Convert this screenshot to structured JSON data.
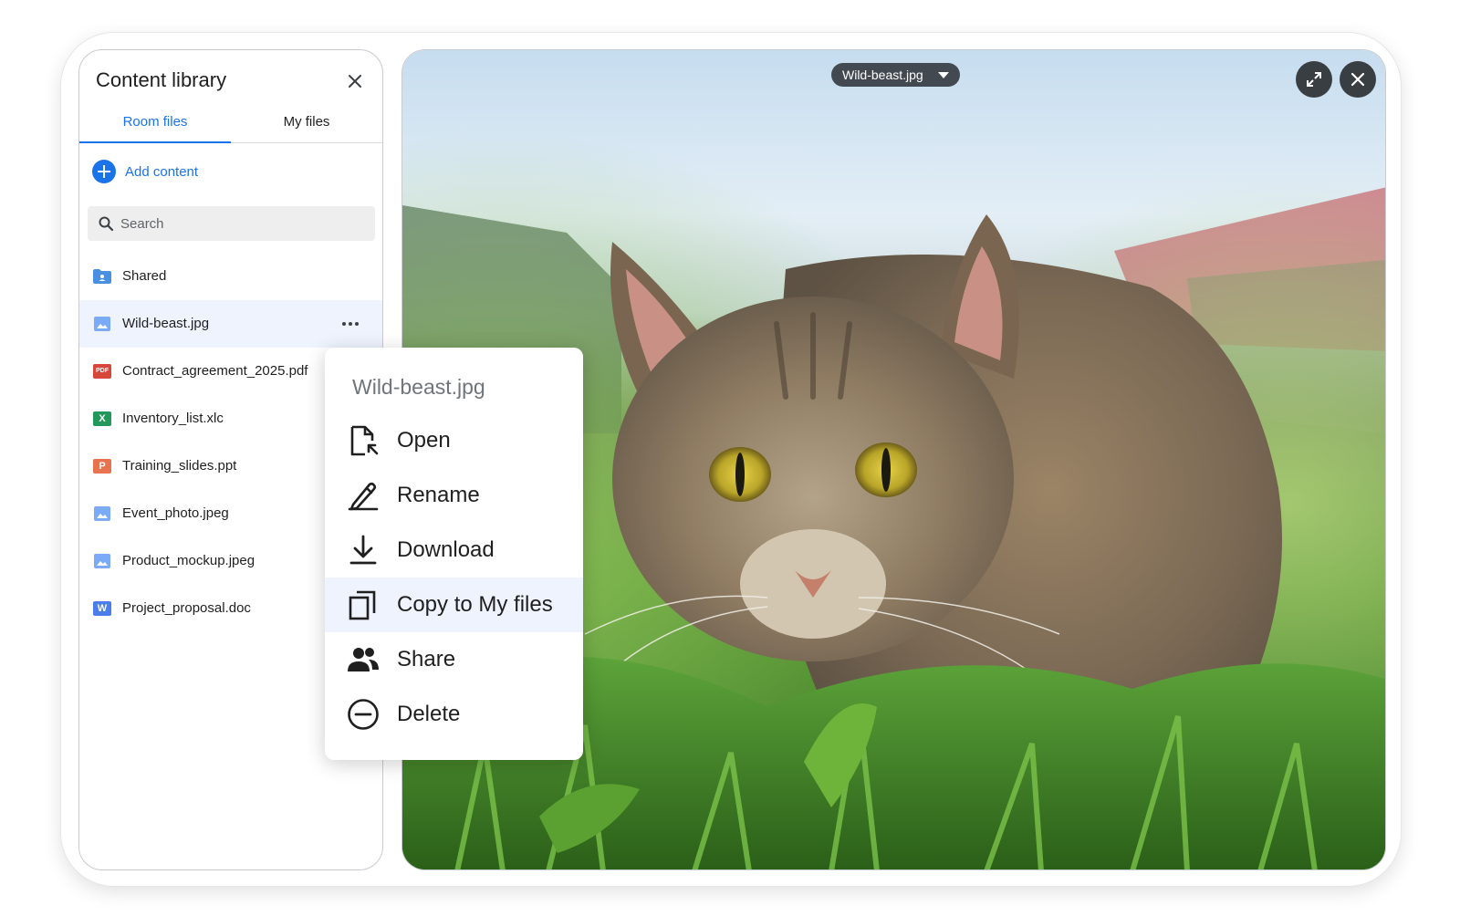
{
  "sidebar": {
    "title": "Content library",
    "tabs": [
      {
        "label": "Room files",
        "active": true
      },
      {
        "label": "My files",
        "active": false
      }
    ],
    "add_content_label": "Add content",
    "search_placeholder": "Search",
    "files": [
      {
        "name": "Shared",
        "icon": "shared-folder-icon",
        "color": "#4a90e2"
      },
      {
        "name": "Wild-beast.jpg",
        "icon": "image-file-icon",
        "color": "#7baaf7",
        "selected": true
      },
      {
        "name": "Contract_agreement_2025.pdf",
        "icon": "pdf-file-icon",
        "color": "#d6473a",
        "letter": "PDF"
      },
      {
        "name": "Inventory_list.xlc",
        "icon": "spreadsheet-file-icon",
        "color": "#23985b",
        "letter": "X"
      },
      {
        "name": "Training_slides.ppt",
        "icon": "presentation-file-icon",
        "color": "#e8744f",
        "letter": "P"
      },
      {
        "name": "Event_photo.jpeg",
        "icon": "image-file-icon",
        "color": "#7baaf7"
      },
      {
        "name": "Product_mockup.jpeg",
        "icon": "image-file-icon",
        "color": "#7baaf7"
      },
      {
        "name": "Project_proposal.doc",
        "icon": "document-file-icon",
        "color": "#4a7ee8",
        "letter": "W"
      }
    ]
  },
  "viewer": {
    "file_name": "Wild-beast.jpg"
  },
  "menu": {
    "title": "Wild-beast.jpg",
    "items": [
      {
        "label": "Open",
        "icon": "open-file-icon"
      },
      {
        "label": "Rename",
        "icon": "rename-pen-icon"
      },
      {
        "label": "Download",
        "icon": "download-icon"
      },
      {
        "label": "Copy to My files",
        "icon": "copy-icon",
        "highlighted": true
      },
      {
        "label": "Share",
        "icon": "share-people-icon"
      },
      {
        "label": "Delete",
        "icon": "delete-minus-icon"
      }
    ]
  },
  "colors": {
    "accent": "#1a73e8",
    "selected_row": "#eef3fd",
    "pill_background": "#373c42"
  }
}
